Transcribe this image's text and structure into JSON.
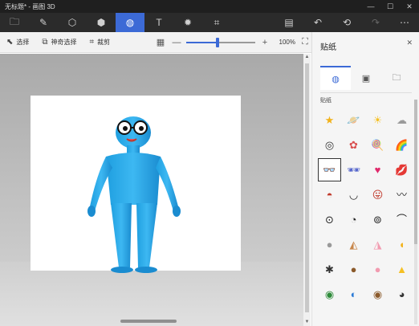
{
  "window": {
    "title": "无标题* - 画图 3D",
    "controls": [
      "—",
      "☐",
      "✕"
    ]
  },
  "toolbar": {
    "left_tools": [
      {
        "name": "menu-folder-icon",
        "glyph": "🗀"
      },
      {
        "name": "brush-icon",
        "glyph": "✎"
      },
      {
        "name": "2d-shapes-icon",
        "glyph": "⬡"
      },
      {
        "name": "3d-shapes-icon",
        "glyph": "⬢"
      },
      {
        "name": "stickers-icon",
        "glyph": "◍"
      },
      {
        "name": "text-icon",
        "glyph": "T"
      },
      {
        "name": "effects-icon",
        "glyph": "✹"
      },
      {
        "name": "canvas-icon",
        "glyph": "⌗"
      }
    ],
    "right_tools": [
      {
        "name": "paste-icon",
        "glyph": "▤"
      },
      {
        "name": "undo-icon",
        "glyph": "↶"
      },
      {
        "name": "history-icon",
        "glyph": "⟲"
      },
      {
        "name": "redo-icon",
        "glyph": "↷"
      },
      {
        "name": "more-icon",
        "glyph": "⋯"
      }
    ],
    "active_index": 4
  },
  "subbar": {
    "select_label": "选择",
    "magic_select_label": "神奇选择",
    "crop_label": "裁剪",
    "zoom_value": "100%",
    "zoom_fraction": 0.45,
    "zoom_minus": "—",
    "zoom_plus": "+"
  },
  "panel": {
    "title": "贴纸",
    "close": "✕",
    "tabs": [
      {
        "name": "stickers-tab",
        "glyph": "◍"
      },
      {
        "name": "textures-tab",
        "glyph": "▣"
      },
      {
        "name": "custom-sticker-tab",
        "glyph": "🗀"
      }
    ],
    "section_label": "贴纸",
    "stickers": [
      {
        "name": "star-sticker",
        "glyph": "★",
        "color": "#f2b21b"
      },
      {
        "name": "planet-sticker",
        "glyph": "🪐",
        "color": "#3ab39a"
      },
      {
        "name": "sun-sticker",
        "glyph": "☀",
        "color": "#f5c023"
      },
      {
        "name": "cloud-sticker",
        "glyph": "☁",
        "color": "#9a9a9a"
      },
      {
        "name": "spiral-sticker",
        "glyph": "◎",
        "color": "#333333"
      },
      {
        "name": "gift-sticker",
        "glyph": "✿",
        "color": "#d94f4f"
      },
      {
        "name": "lollipop-sticker",
        "glyph": "🍭",
        "color": "#d94fa8"
      },
      {
        "name": "rainbow-sticker",
        "glyph": "🌈",
        "color": "#e06a3a"
      },
      {
        "name": "glasses-sticker",
        "glyph": "👓",
        "color": "#222222"
      },
      {
        "name": "sunglasses-sticker",
        "glyph": "🕶",
        "color": "#5566cc"
      },
      {
        "name": "heart-sticker",
        "glyph": "♥",
        "color": "#e0296b"
      },
      {
        "name": "lips-sticker",
        "glyph": "💋",
        "color": "#d42a2a"
      },
      {
        "name": "open-mouth-sticker",
        "glyph": "◓",
        "color": "#c0392b"
      },
      {
        "name": "grin-sticker",
        "glyph": "◡",
        "color": "#222222"
      },
      {
        "name": "tongue-sticker",
        "glyph": "😛",
        "color": "#c0392b"
      },
      {
        "name": "mustache-sticker",
        "glyph": "〰",
        "color": "#222222"
      },
      {
        "name": "eye-sticker",
        "glyph": "⊙",
        "color": "#222222"
      },
      {
        "name": "eye-look-sticker",
        "glyph": "◔",
        "color": "#222222"
      },
      {
        "name": "eye-small-sticker",
        "glyph": "⊚",
        "color": "#222222"
      },
      {
        "name": "eyebrow-sticker",
        "glyph": "⌒",
        "color": "#222222"
      },
      {
        "name": "gray-ear-sticker",
        "glyph": "●",
        "color": "#9a9a9a"
      },
      {
        "name": "horse-ear-sticker",
        "glyph": "◭",
        "color": "#c8864a"
      },
      {
        "name": "pink-ear-sticker",
        "glyph": "◮",
        "color": "#f29bb0"
      },
      {
        "name": "yellow-ear-sticker",
        "glyph": "◖",
        "color": "#f2b21b"
      },
      {
        "name": "whisker-nose-sticker",
        "glyph": "✱",
        "color": "#333333"
      },
      {
        "name": "dog-nose-sticker",
        "glyph": "●",
        "color": "#8b5a2b"
      },
      {
        "name": "pig-nose-sticker",
        "glyph": "●",
        "color": "#f29bb0"
      },
      {
        "name": "beak-sticker",
        "glyph": "▲",
        "color": "#f5c023"
      },
      {
        "name": "cat-eye-sticker",
        "glyph": "◉",
        "color": "#2e8b3a"
      },
      {
        "name": "blue-eye-sticker",
        "glyph": "◐",
        "color": "#2a7ad6"
      },
      {
        "name": "brown-eye-sticker",
        "glyph": "◉",
        "color": "#8b5a2b"
      },
      {
        "name": "lash-eye-sticker",
        "glyph": "◕",
        "color": "#333333"
      }
    ],
    "selected_index": 8
  }
}
